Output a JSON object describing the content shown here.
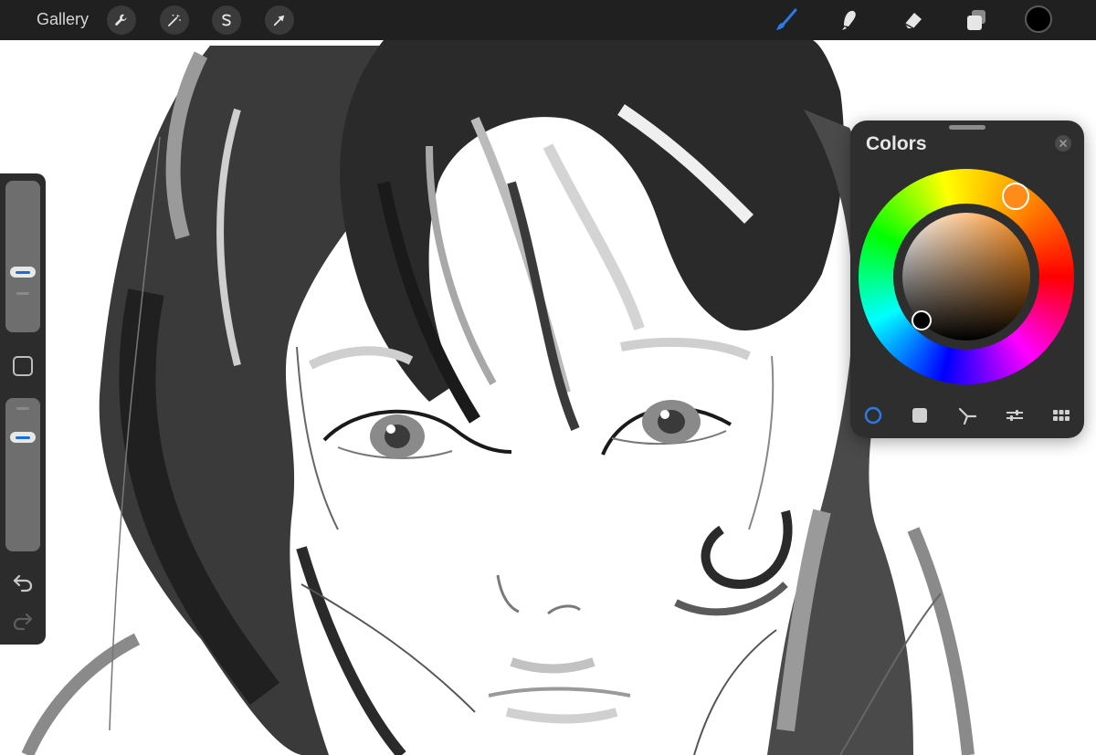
{
  "toolbar": {
    "gallery_label": "Gallery",
    "left_tools": [
      "wrench-icon",
      "magic-wand-icon",
      "selection-s-icon",
      "transform-arrow-icon"
    ],
    "right_tools": [
      "brush-icon",
      "smudge-icon",
      "eraser-icon",
      "layers-icon"
    ],
    "active_tool": "brush-icon",
    "accent_color": "#1a6cd6",
    "current_color": "#000000"
  },
  "sidebar": {
    "brush_size_level": 0.42,
    "opacity_level": 0.88,
    "tools": [
      "modify-square-icon",
      "undo-icon",
      "redo-icon"
    ]
  },
  "colors_panel": {
    "title": "Colors",
    "hue_color": "#ff8c1a",
    "selected_color": "#000000",
    "modes": [
      "disc",
      "classic",
      "harmony",
      "value",
      "palettes"
    ],
    "active_mode": "disc"
  }
}
